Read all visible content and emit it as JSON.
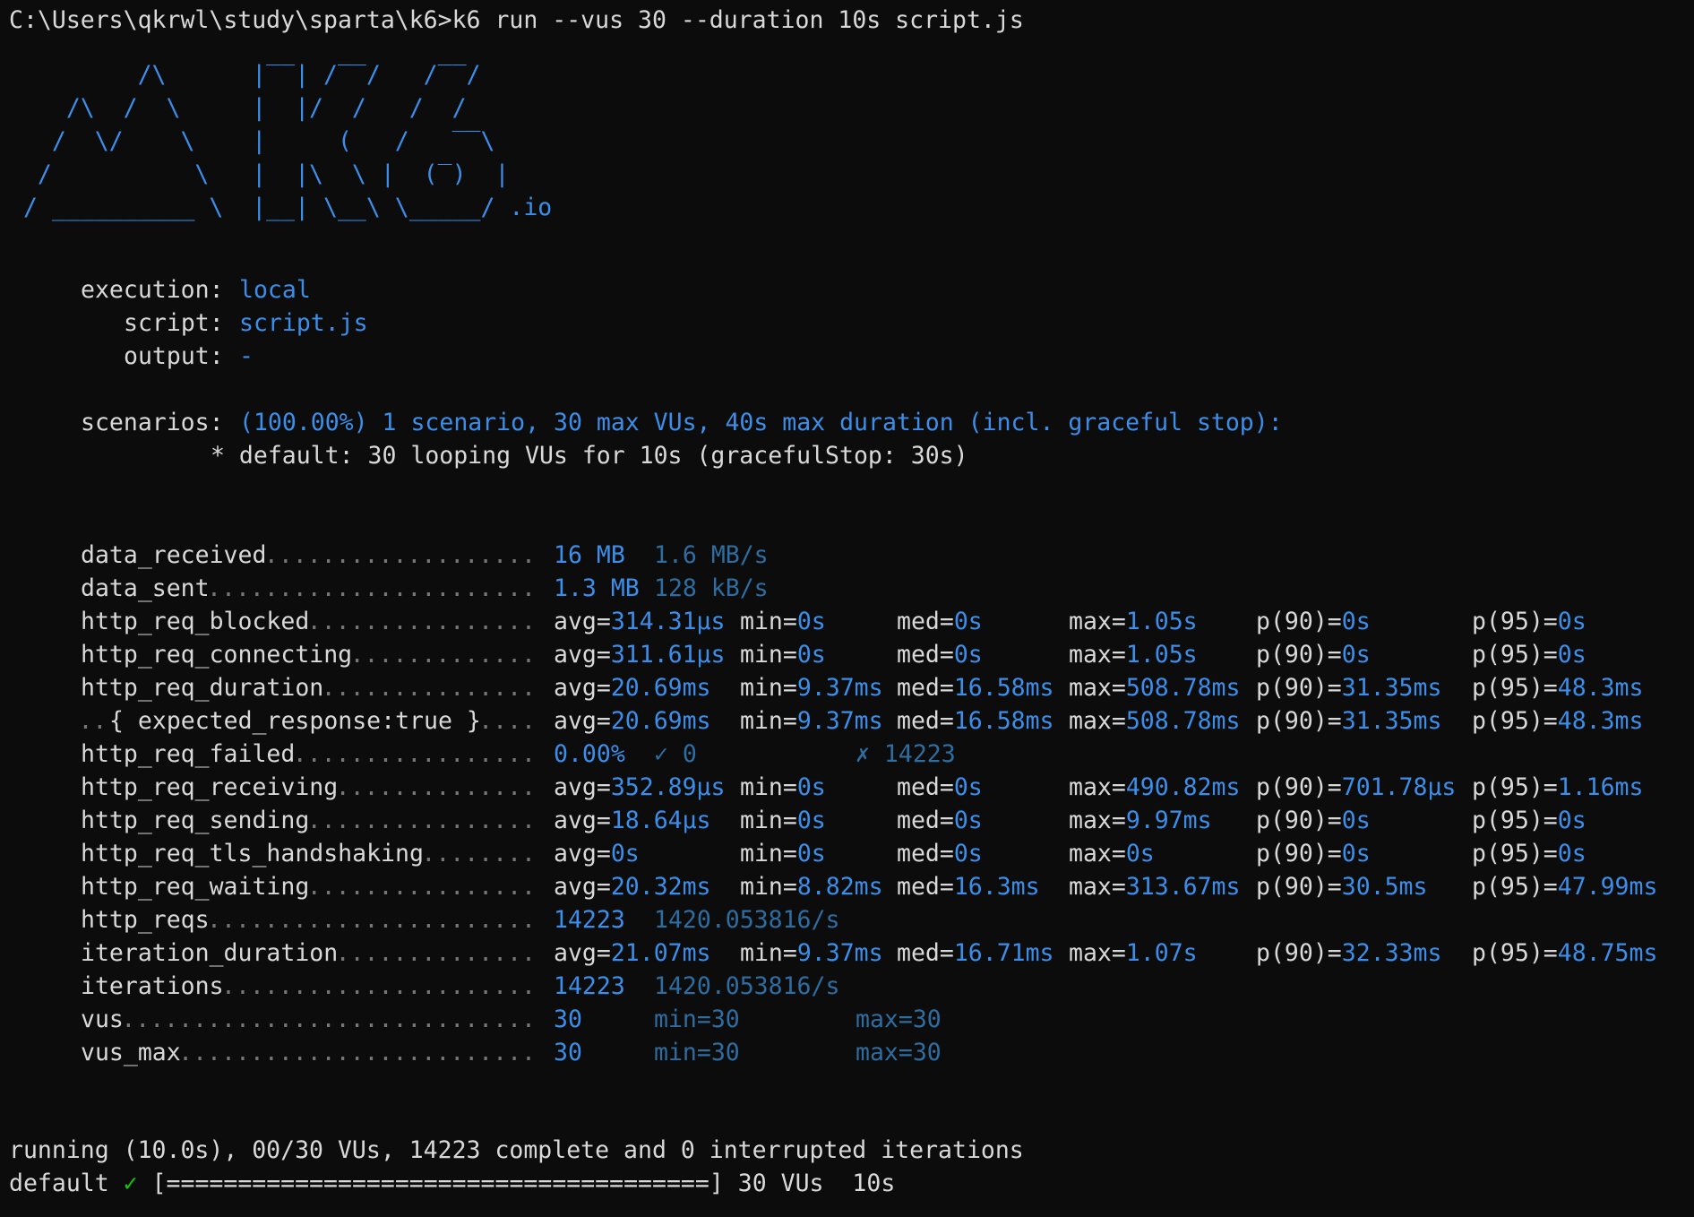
{
  "terminal": {
    "prompt": "C:\\Users\\qkrwl\\study\\sparta\\k6>",
    "command": "k6 run --vus 30 --duration 10s script.js"
  },
  "logo": {
    "art": "         /\\      |‾‾| /‾‾/   /‾‾/\n    /\\  /  \\     |  |/  /   /  /\n   /  \\/    \\    |     (   /   ‾‾\\\n  /          \\   |  |\\  \\ |  (‾)  |\n / __________ \\  |__| \\__\\ \\_____/ .io"
  },
  "options": {
    "execution_label": "execution:",
    "execution_value": "local",
    "script_label": "script:",
    "script_value": "script.js",
    "output_label": "output:",
    "output_value": "-",
    "scenarios_label": "scenarios:",
    "scenarios_value": "(100.00%) 1 scenario, 30 max VUs, 40s max duration (incl. graceful stop):",
    "default_line": "* default: 30 looping VUs for 10s (gracefulStop: 30s)"
  },
  "metrics": [
    {
      "name": "data_received",
      "indent": false,
      "type": "rate",
      "value": "16 MB",
      "rate": "1.6 MB/s"
    },
    {
      "name": "data_sent",
      "indent": false,
      "type": "rate",
      "value": "1.3 MB",
      "rate": "128 kB/s"
    },
    {
      "name": "http_req_blocked",
      "indent": false,
      "type": "trend",
      "avg": "314.31µs",
      "min": "0s",
      "med": "0s",
      "max": "1.05s",
      "p90": "0s",
      "p95": "0s"
    },
    {
      "name": "http_req_connecting",
      "indent": false,
      "type": "trend",
      "avg": "311.61µs",
      "min": "0s",
      "med": "0s",
      "max": "1.05s",
      "p90": "0s",
      "p95": "0s"
    },
    {
      "name": "http_req_duration",
      "indent": false,
      "type": "trend",
      "avg": "20.69ms",
      "min": "9.37ms",
      "med": "16.58ms",
      "max": "508.78ms",
      "p90": "31.35ms",
      "p95": "48.3ms"
    },
    {
      "name": "{ expected_response:true }",
      "indent": true,
      "type": "trend",
      "avg": "20.69ms",
      "min": "9.37ms",
      "med": "16.58ms",
      "max": "508.78ms",
      "p90": "31.35ms",
      "p95": "48.3ms"
    },
    {
      "name": "http_req_failed",
      "indent": false,
      "type": "rate3",
      "value": "0.00%",
      "pass": "✓ 0",
      "fail": "✗ 14223"
    },
    {
      "name": "http_req_receiving",
      "indent": false,
      "type": "trend",
      "avg": "352.89µs",
      "min": "0s",
      "med": "0s",
      "max": "490.82ms",
      "p90": "701.78µs",
      "p95": "1.16ms"
    },
    {
      "name": "http_req_sending",
      "indent": false,
      "type": "trend",
      "avg": "18.64µs",
      "min": "0s",
      "med": "0s",
      "max": "9.97ms",
      "p90": "0s",
      "p95": "0s"
    },
    {
      "name": "http_req_tls_handshaking",
      "indent": false,
      "type": "trend",
      "avg": "0s",
      "min": "0s",
      "med": "0s",
      "max": "0s",
      "p90": "0s",
      "p95": "0s"
    },
    {
      "name": "http_req_waiting",
      "indent": false,
      "type": "trend",
      "avg": "20.32ms",
      "min": "8.82ms",
      "med": "16.3ms",
      "max": "313.67ms",
      "p90": "30.5ms",
      "p95": "47.99ms"
    },
    {
      "name": "http_reqs",
      "indent": false,
      "type": "rate",
      "value": "14223",
      "rate": "1420.053816/s"
    },
    {
      "name": "iteration_duration",
      "indent": false,
      "type": "trend",
      "avg": "21.07ms",
      "min": "9.37ms",
      "med": "16.71ms",
      "max": "1.07s",
      "p90": "32.33ms",
      "p95": "48.75ms"
    },
    {
      "name": "iterations",
      "indent": false,
      "type": "rate",
      "value": "14223",
      "rate": "1420.053816/s"
    },
    {
      "name": "vus",
      "indent": false,
      "type": "gauge",
      "value": "30",
      "min": "min=30",
      "max": "max=30"
    },
    {
      "name": "vus_max",
      "indent": false,
      "type": "gauge",
      "value": "30",
      "min": "min=30",
      "max": "max=30"
    }
  ],
  "footer": {
    "running_line": "running (10.0s), 00/30 VUs, 14223 complete and 0 interrupted iterations",
    "scenario_name": "default",
    "check_mark": "✓",
    "progress_bar": "[======================================]",
    "progress": 1.0,
    "vus_text": "30 VUs",
    "duration_text": "10s"
  },
  "colors": {
    "background": "#0c0c0c",
    "text": "#d9d9d9",
    "accent": "#3b8eea",
    "dim_accent": "#2e6da1",
    "dots": "#767676",
    "success": "#16c60c"
  }
}
